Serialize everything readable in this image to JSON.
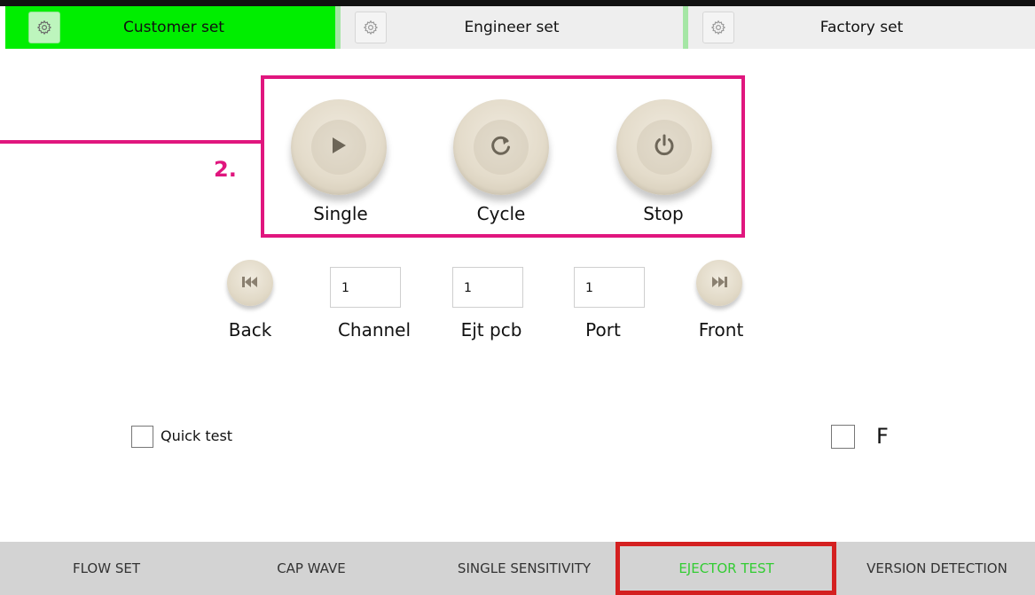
{
  "top_tabs": [
    {
      "label": "Customer set",
      "icon": "gear-icon",
      "active": true
    },
    {
      "label": "Engineer set",
      "icon": "gear-icon",
      "active": false
    },
    {
      "label": "Factory set",
      "icon": "gear-icon",
      "active": false
    }
  ],
  "callout": {
    "number": "2.",
    "color": "#e0167e"
  },
  "main_buttons": [
    {
      "label": "Single",
      "icon": "play-icon"
    },
    {
      "label": "Cycle",
      "icon": "refresh-icon"
    },
    {
      "label": "Stop",
      "icon": "power-icon"
    }
  ],
  "nav": {
    "back": {
      "label": "Back",
      "icon": "skip-back-icon"
    },
    "front": {
      "label": "Front",
      "icon": "skip-forward-icon"
    }
  },
  "fields": [
    {
      "label": "Channel",
      "value": "1"
    },
    {
      "label": "Ejt pcb",
      "value": "1"
    },
    {
      "label": "Port",
      "value": "1"
    }
  ],
  "checkboxes": {
    "quick_test": {
      "label": "Quick test",
      "checked": false
    },
    "f": {
      "label": "F",
      "checked": false
    }
  },
  "bottom_tabs": [
    {
      "label": "FLOW SET",
      "active": false
    },
    {
      "label": "CAP WAVE",
      "active": false
    },
    {
      "label": "SINGLE SENSITIVITY",
      "active": false
    },
    {
      "label": "EJECTOR TEST",
      "active": true
    },
    {
      "label": "VERSION DETECTION",
      "active": false
    }
  ],
  "colors": {
    "active_tab": "#00ee00",
    "active_bottom_text": "#33cc33",
    "highlight_box": "#d42020",
    "button_face": "#e4dccb"
  }
}
